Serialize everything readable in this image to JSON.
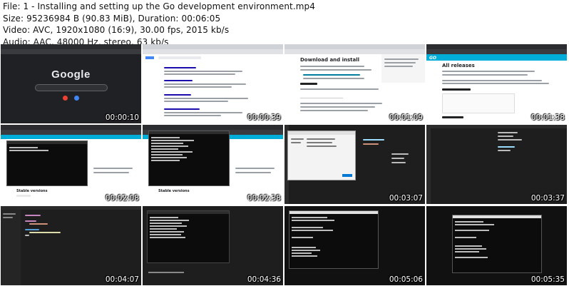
{
  "info": {
    "file": "File: 1 - Installing and setting up the Go development environment.mp4",
    "size": "Size: 95236984 B (90.83 MiB), Duration: 00:06:05",
    "video": "Video: AVC, 1920x1080 (16:9), 30.00 fps, 2015 kb/s",
    "audio": "Audio: AAC, 48000 Hz, stereo, 63 kb/s"
  },
  "thumbnails": [
    {
      "timestamp": "00:00:10",
      "scene": "google-home",
      "logo": "Google"
    },
    {
      "timestamp": "00:00:39",
      "scene": "google-results"
    },
    {
      "timestamp": "00:01:09",
      "scene": "go-download",
      "heading": "Download and install"
    },
    {
      "timestamp": "00:01:38",
      "scene": "go-releases",
      "heading": "All releases"
    },
    {
      "timestamp": "00:02:08",
      "scene": "terminal-over-page",
      "footer": "Stable versions"
    },
    {
      "timestamp": "00:02:38",
      "scene": "terminal-over-page",
      "footer": "Stable versions"
    },
    {
      "timestamp": "00:03:07",
      "scene": "file-dialog-editor"
    },
    {
      "timestamp": "00:03:37",
      "scene": "editor-dark"
    },
    {
      "timestamp": "00:04:07",
      "scene": "editor-code"
    },
    {
      "timestamp": "00:04:36",
      "scene": "terminal-dark"
    },
    {
      "timestamp": "00:05:06",
      "scene": "terminal-window"
    },
    {
      "timestamp": "00:05:35",
      "scene": "terminal-window-small"
    }
  ],
  "colors": {
    "go_blue": "#00add8",
    "google_blue": "#4285f4",
    "google_red": "#ea4335",
    "google_yellow": "#fbbc05",
    "google_green": "#34a853",
    "terminal_bg": "#0c0c0c"
  }
}
